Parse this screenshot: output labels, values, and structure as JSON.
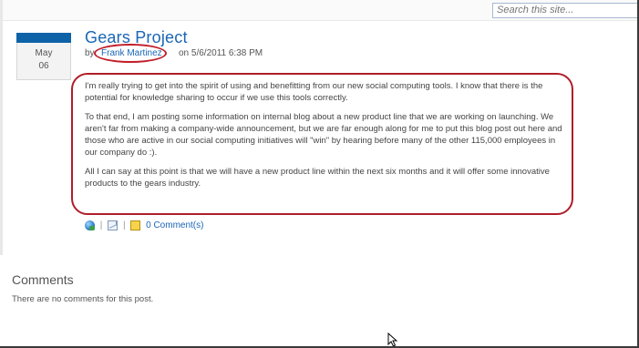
{
  "search": {
    "placeholder": "Search this site..."
  },
  "post": {
    "month": "May",
    "day": "06",
    "title": "Gears Project",
    "by_prefix": "by",
    "author": "Frank Martinez",
    "on_date": "on 5/6/2011 6:38 PM",
    "paragraphs": [
      "I'm really trying to get into the spirit of using and benefitting from our new social computing tools.  I know that there is the potential for knowledge sharing to occur if we use this tools correctly.",
      "To that end, I am posting some information on internal blog about a new product line that we are working on launching.  We aren't far from making a company-wide announcement, but we are far enough along for me to put this blog post out here and those who are active in our social computing initiatives will \"win\" by hearing before many of the other 115,000 employees in our company do :).",
      "All I can say at this point is that we will have a new product line within the next six months and it will offer some innovative products to the gears industry."
    ],
    "actions": {
      "separator": "|",
      "comments_link": "0 Comment(s)"
    }
  },
  "comments": {
    "heading": "Comments",
    "empty_text": "There are no comments for this post."
  },
  "colors": {
    "accent": "#1a66b5",
    "date_bar": "#0e63a8",
    "annotation": "#c21c28"
  },
  "icons": [
    "globe-icon",
    "email-icon",
    "comment-icon",
    "mouse-cursor-icon"
  ]
}
